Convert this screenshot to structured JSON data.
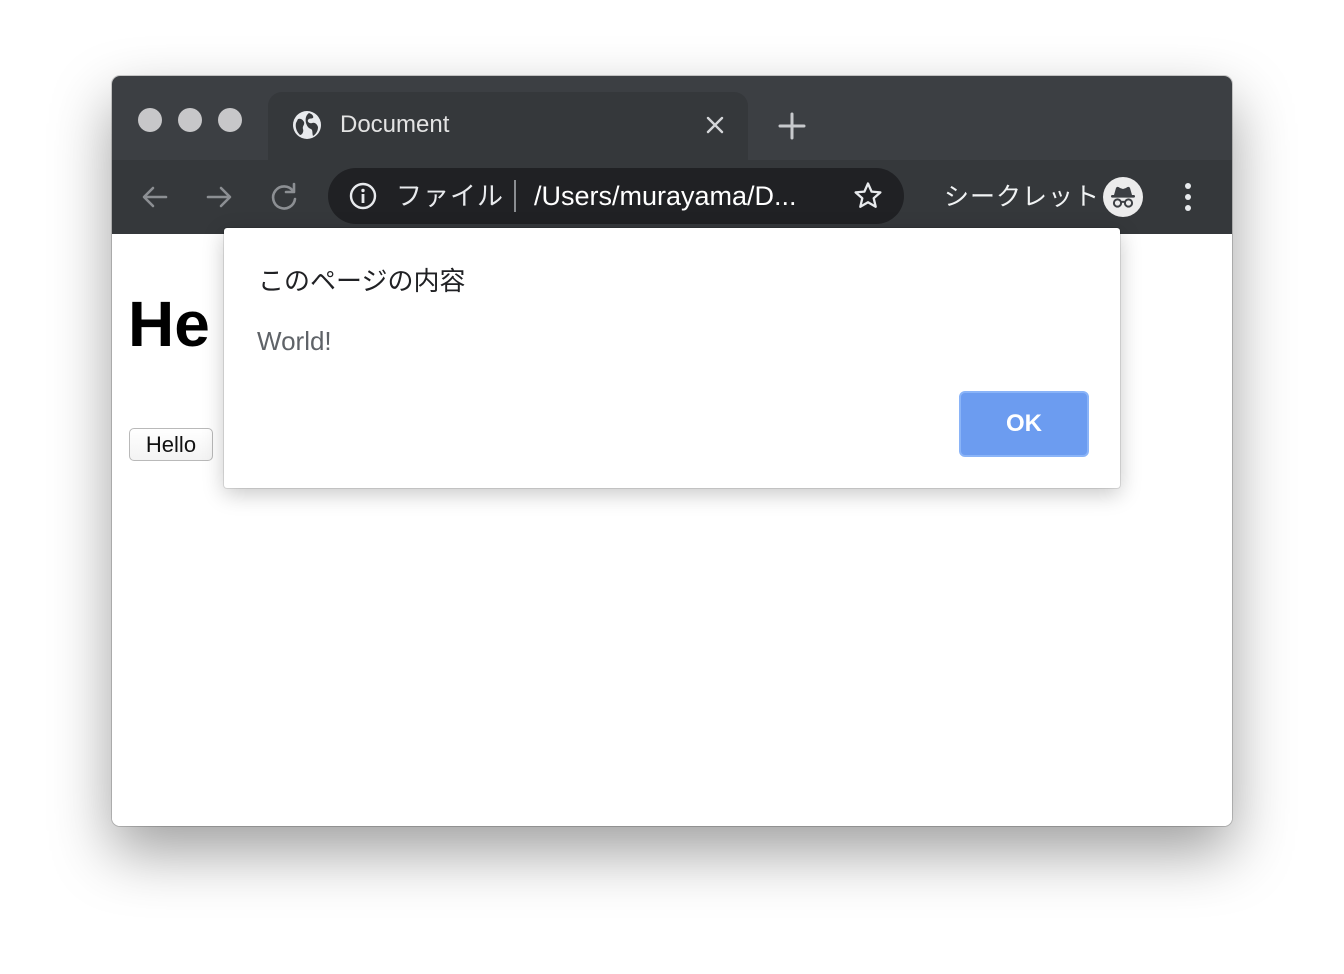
{
  "window": {
    "tab": {
      "title": "Document",
      "favicon": "globe-icon",
      "close_icon": "close-icon"
    },
    "new_tab_icon": "plus-icon"
  },
  "toolbar": {
    "back_icon": "arrow-left-icon",
    "forward_icon": "arrow-right-icon",
    "reload_icon": "reload-icon",
    "omnibox": {
      "info_icon": "info-icon",
      "scheme_label": "ファイル",
      "url": "/Users/murayama/D...",
      "bookmark_icon": "star-icon"
    },
    "incognito_label": "シークレット",
    "incognito_icon": "incognito-icon",
    "menu_icon": "more-vert-icon"
  },
  "page": {
    "heading": "He",
    "button_label": "Hello"
  },
  "dialog": {
    "title": "このページの内容",
    "message": "World!",
    "ok_label": "OK"
  },
  "colors": {
    "tabstrip": "#3c3f43",
    "toolbar": "#35383b",
    "omnibox": "#202124",
    "ok_button": "#6c9cf0",
    "traffic_light": "#c7c7c9"
  }
}
